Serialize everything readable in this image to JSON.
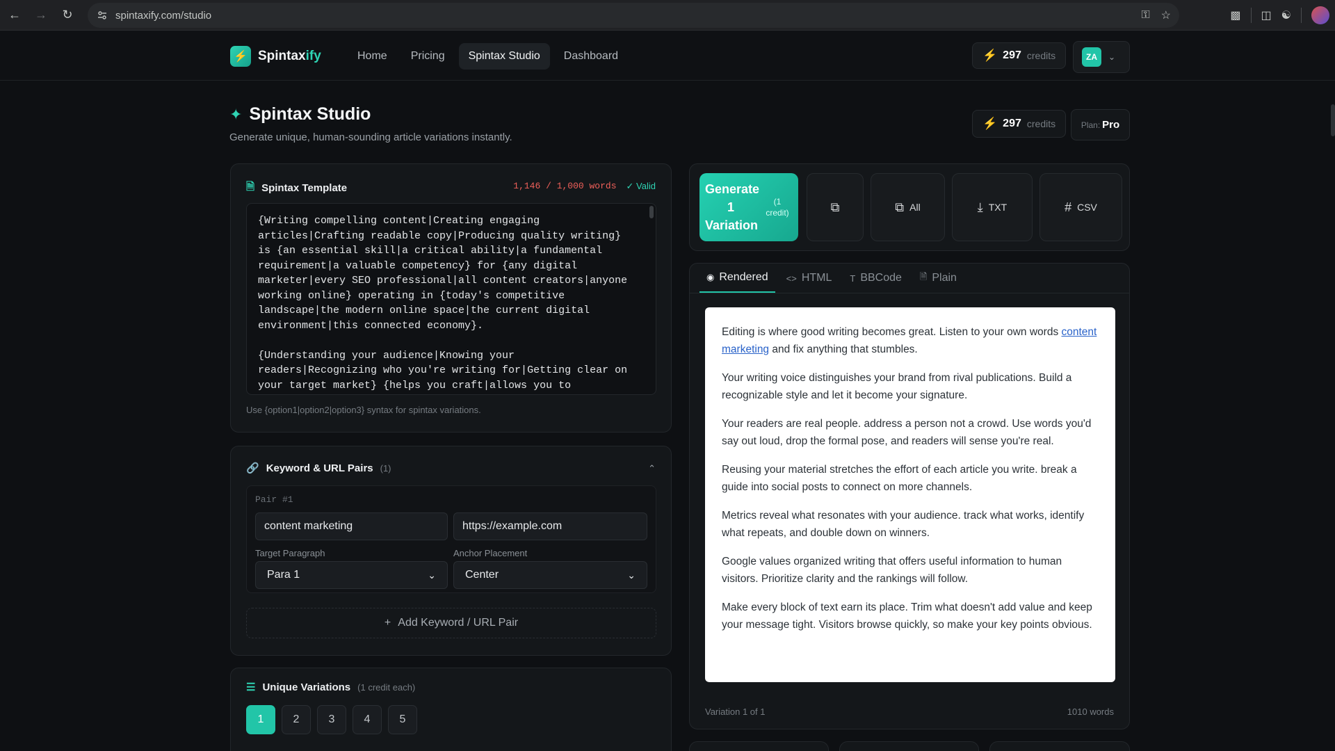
{
  "browser": {
    "url": "spintaxify.com/studio"
  },
  "nav": {
    "brand_prefix": "Spintax",
    "brand_suffix": "ify",
    "links": [
      "Home",
      "Pricing",
      "Spintax Studio",
      "Dashboard"
    ],
    "active_link": "Spintax Studio",
    "credits_value": "297",
    "credits_label": "credits",
    "user_initials": "ZA"
  },
  "page": {
    "title": "Spintax Studio",
    "subtitle": "Generate unique, human-sounding article variations instantly.",
    "credits_value": "297",
    "credits_label": "credits",
    "plan_label": "Plan:",
    "plan_value": "Pro"
  },
  "template_card": {
    "title": "Spintax Template",
    "word_count": "1,146 / 1,000 words",
    "valid_label": "Valid",
    "content": "{Writing compelling content|Creating engaging\narticles|Crafting readable copy|Producing quality writing}\nis {an essential skill|a critical ability|a fundamental\nrequirement|a valuable competency} for {any digital\nmarketer|every SEO professional|all content creators|anyone\nworking online} operating in {today's competitive\nlandscape|the modern online space|the current digital\nenvironment|this connected economy}.\n\n{Understanding your audience|Knowing your\nreaders|Recognizing who you're writing for|Getting clear on\nyour target market} {helps you craft|allows you to",
    "hint": "Use {option1|option2|option3} syntax for spintax variations."
  },
  "keyword_card": {
    "title": "Keyword & URL Pairs",
    "count": "(1)",
    "pair_label": "Pair #1",
    "keyword_value": "content marketing",
    "url_value": "https://example.com",
    "target_paragraph_label": "Target Paragraph",
    "target_paragraph_value": "Para 1",
    "anchor_placement_label": "Anchor Placement",
    "anchor_placement_value": "Center",
    "add_button": "Add Keyword / URL Pair"
  },
  "variations_card": {
    "title": "Unique Variations",
    "note": "(1 credit each)",
    "options": [
      "1",
      "2",
      "3",
      "4",
      "5"
    ],
    "selected": "1"
  },
  "toolbar": {
    "generate_main": "Generate 1 Variation",
    "generate_sub": "(1 credit)",
    "all_label": "All",
    "txt_label": "TXT",
    "csv_label": "CSV"
  },
  "preview": {
    "tabs": [
      "Rendered",
      "HTML",
      "BBCode",
      "Plain"
    ],
    "active_tab": "Rendered",
    "p1_before": "Editing is where good writing becomes great. Listen to your own words ",
    "p1_link": "content marketing",
    "p1_after": " and fix anything that stumbles.",
    "paragraphs": [
      "Your writing voice distinguishes your brand from rival publications. Build a recognizable style and let it become your signature.",
      "Your readers are real people. address a person not a crowd. Use words you'd say out loud, drop the formal pose, and readers will sense you're real.",
      "Reusing your material stretches the effort of each article you write. break a guide into social posts to connect on more channels.",
      "Metrics reveal what resonates with your audience. track what works, identify what repeats, and double down on winners.",
      "Google values organized writing that offers useful information to human visitors. Prioritize clarity and the rankings will follow.",
      "Make every block of text earn its place. Trim what doesn't add value and keep your message tight. Visitors browse quickly, so make your key points obvious."
    ],
    "footer_left": "Variation 1 of 1",
    "footer_right": "1010 words"
  },
  "colors": {
    "accent": "#22c5a8",
    "warning": "#f0605a",
    "link": "#2962c9"
  }
}
